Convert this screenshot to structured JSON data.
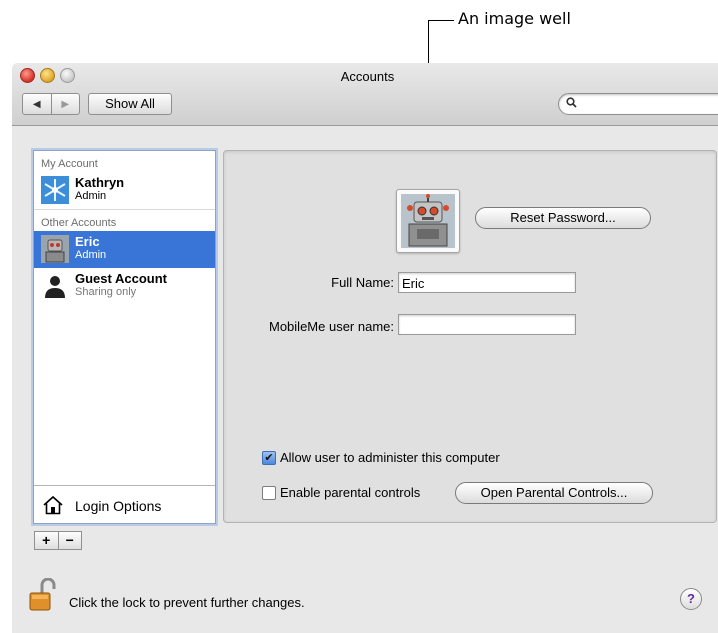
{
  "callout": {
    "label": "An image well"
  },
  "window": {
    "title": "Accounts",
    "show_all": "Show All",
    "search_placeholder": ""
  },
  "sidebar": {
    "section_my": "My Account",
    "section_other": "Other Accounts",
    "accounts": [
      {
        "name": "Kathryn",
        "role": "Admin",
        "selected": false
      },
      {
        "name": "Eric",
        "role": "Admin",
        "selected": true
      },
      {
        "name": "Guest Account",
        "role": "Sharing only",
        "selected": false
      }
    ],
    "login_options": "Login Options",
    "add": "+",
    "remove": "−"
  },
  "main": {
    "reset_password": "Reset Password...",
    "full_name_label": "Full Name:",
    "full_name_value": "Eric",
    "mobileme_label": "MobileMe user name:",
    "mobileme_value": "",
    "allow_admin_label": "Allow user to administer this computer",
    "allow_admin_checked": true,
    "parental_label": "Enable parental controls",
    "parental_checked": false,
    "open_parental": "Open Parental Controls..."
  },
  "footer": {
    "lock_text": "Click the lock to prevent further changes.",
    "help": "?"
  },
  "colors": {
    "selection": "#3875d7",
    "window_bg": "#e8e8e8"
  }
}
